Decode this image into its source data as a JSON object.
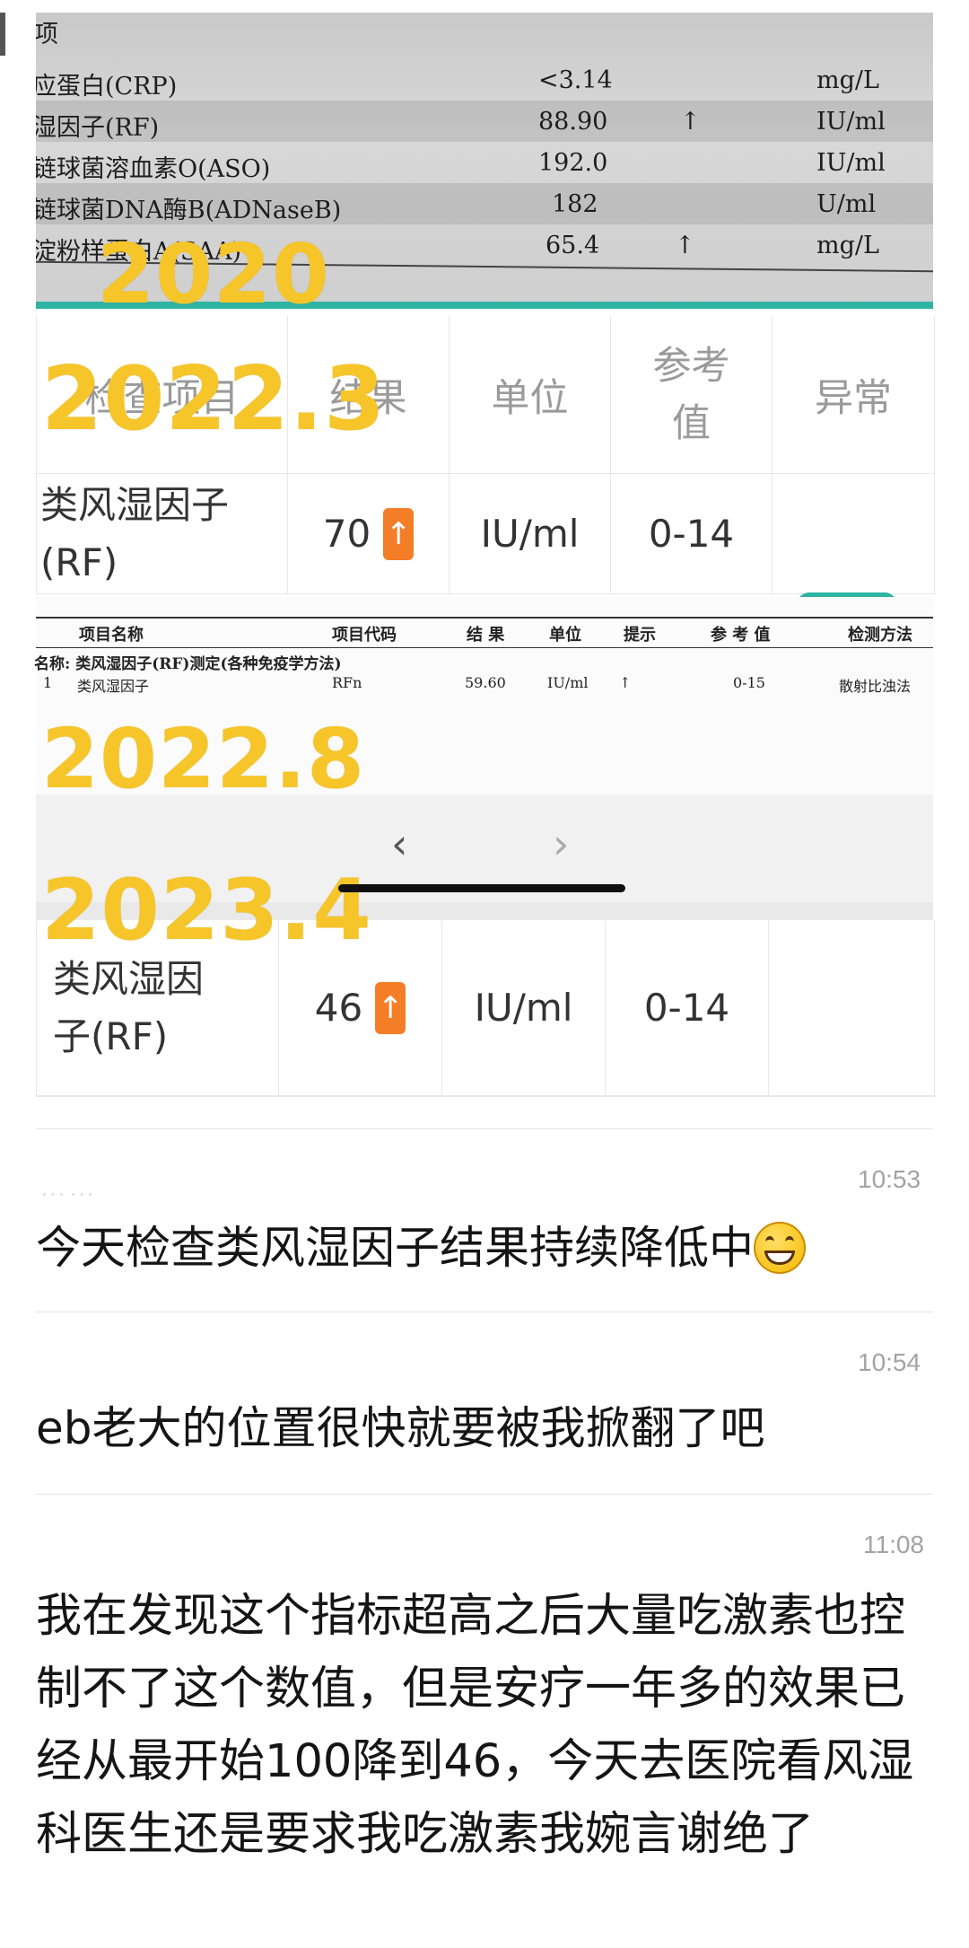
{
  "photo_2020": {
    "header_partial": "项",
    "rows": [
      {
        "name": "应蛋白(CRP)",
        "value": "<3.14",
        "flag": "",
        "unit": "mg/L"
      },
      {
        "name": "湿因子(RF)",
        "value": "88.90",
        "flag": "↑",
        "unit": "IU/ml"
      },
      {
        "name": "链球菌溶血素O(ASO)",
        "value": "192.0",
        "flag": "",
        "unit": "IU/ml"
      },
      {
        "name": "链球菌DNA酶B(ADNaseB)",
        "value": "182",
        "flag": "",
        "unit": "U/ml"
      },
      {
        "name": "淀粉样蛋白A(SAA)",
        "value": "65.4",
        "flag": "↑",
        "unit": "mg/L"
      }
    ]
  },
  "years": {
    "y2020": "2020",
    "y2022_3": "2022.3",
    "y2022_8": "2022.8",
    "y2023_4": "2023.4"
  },
  "table_2022_3": {
    "headers": [
      "检查项目",
      "结果",
      "单位",
      "参考值",
      "异常"
    ],
    "row": {
      "name": "类风湿因子(RF)",
      "result": "70",
      "flag": "↑",
      "unit": "IU/ml",
      "reference": "0-14",
      "abnormal": ""
    }
  },
  "report_2022_8": {
    "headers": [
      "项目名称",
      "项目代码",
      "结 果",
      "单位",
      "提示",
      "参 考 值",
      "检测方法"
    ],
    "section_title": "名称: 类风湿因子(RF)测定(各种免疫学方法)",
    "row": {
      "index": "1",
      "name": "类风湿因子",
      "code": "RFn",
      "result": "59.60",
      "unit": "IU/ml",
      "flag": "↑",
      "reference": "0-15",
      "method": "散射比浊法"
    }
  },
  "navbar": {
    "back_icon": "‹",
    "forward_icon": "›"
  },
  "table_2023_4": {
    "row": {
      "name": "类风湿因子(RF)",
      "result": "46",
      "flag": "↑",
      "unit": "IU/ml",
      "reference": "0-14",
      "abnormal": ""
    }
  },
  "comments": [
    {
      "time": "10:53",
      "text": "今天检查类风湿因子结果持续降低中",
      "emoji": "grinning-face"
    },
    {
      "time": "10:54",
      "text": "eb老大的位置很快就要被我掀翻了吧"
    },
    {
      "time": "11:08",
      "text": "我在发现这个指标超高之后大量吃激素也控制不了这个数值，但是安疗一年多的效果已经从最开始100降到46，今天去医院看风湿科医生还是要求我吃激素我婉言谢绝了"
    }
  ],
  "colors": {
    "year_label": "#f6c52a",
    "arrow_badge": "#f47e28",
    "teal_strip": "#2fb3a3"
  }
}
